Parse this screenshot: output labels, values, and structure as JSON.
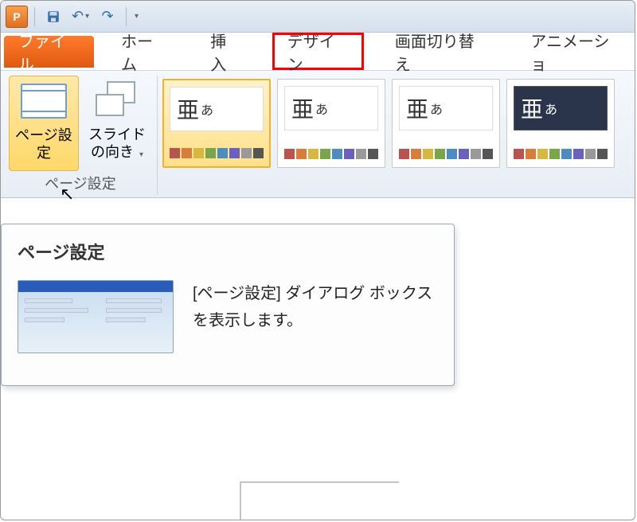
{
  "qat": {
    "app_letter": "P",
    "save": "保存",
    "undo": "元に戻す",
    "redo": "やり直し"
  },
  "tabs": {
    "file": "ファイル",
    "home": "ホーム",
    "insert": "挿入",
    "design": "デザイン",
    "transitions": "画面切り替え",
    "animations": "アニメーショ"
  },
  "ribbon": {
    "page_setup": "ページ設定",
    "orientation": "スライドの向き",
    "group_label": "ページ設定"
  },
  "themes": {
    "sample_main": "亜",
    "sample_sub": "あ",
    "swatch_sets": [
      [
        "#b85450",
        "#d97c3c",
        "#d7b740",
        "#7aa64b",
        "#4c8cbf",
        "#6b5fbf",
        "#999999",
        "#555555"
      ],
      [
        "#b85450",
        "#d97c3c",
        "#d7b740",
        "#7aa64b",
        "#4c8cbf",
        "#6b5fbf",
        "#999999",
        "#555555"
      ],
      [
        "#b85450",
        "#d97c3c",
        "#d7b740",
        "#7aa64b",
        "#4c8cbf",
        "#6b5fbf",
        "#999999",
        "#555555"
      ],
      [
        "#b85450",
        "#d97c3c",
        "#d7b740",
        "#7aa64b",
        "#4c8cbf",
        "#6b5fbf",
        "#999999",
        "#555555"
      ]
    ]
  },
  "tooltip": {
    "title": "ページ設定",
    "desc": "[ページ設定] ダイアログ ボックスを表示します。"
  },
  "highlight_color": "#ff0000"
}
